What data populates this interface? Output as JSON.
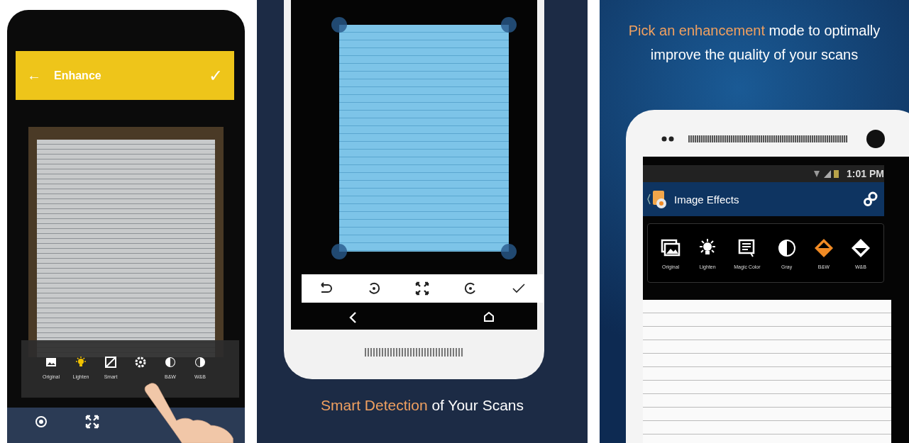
{
  "left_screen": {
    "back_icon": "←",
    "title": "Enhance",
    "confirm_icon": "✓",
    "filters": [
      {
        "label": "Original",
        "selected": false
      },
      {
        "label": "Lighten",
        "selected": true
      },
      {
        "label": "Smart",
        "selected": false
      },
      {
        "selected": false
      },
      {
        "label": "B&W",
        "selected": false
      },
      {
        "label": "W&B",
        "selected": false
      }
    ]
  },
  "middle_screen": {
    "caption": [
      {
        "text": "Smart Detection",
        "highlight": true
      },
      {
        "text": " of Your Scans",
        "highlight": false
      }
    ]
  },
  "right_screen": {
    "heading": [
      {
        "text": "Pick an enhancement",
        "highlight": true
      },
      {
        "text": " mode to optimally improve the quality of your scans",
        "highlight": false
      }
    ],
    "status_time": "1:01 PM",
    "title": "Image Effects",
    "effects": [
      {
        "label": "Original",
        "selected": false
      },
      {
        "label": "Lighten",
        "selected": false
      },
      {
        "label": "Magic Color",
        "selected": false
      },
      {
        "label": "Gray",
        "selected": false
      },
      {
        "label": "B&W",
        "selected": true
      },
      {
        "label": "W&B",
        "selected": false
      }
    ]
  }
}
